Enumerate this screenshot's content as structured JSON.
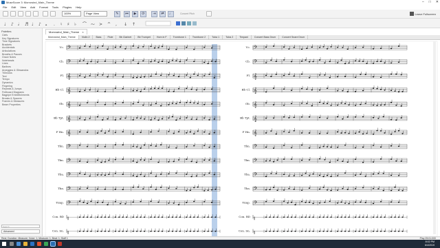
{
  "window": {
    "title": "MuseScore 3: Morrowind_Main_Theme",
    "controls": [
      "–",
      "□",
      "✕"
    ]
  },
  "menus": [
    "File",
    "Edit",
    "View",
    "Add",
    "Format",
    "Tools",
    "Plugins",
    "Help"
  ],
  "toolbar": {
    "zoom": "100%",
    "view_mode": "Page View",
    "concert_pitch": "Concert Pitch",
    "leave_fullscreen": "Leave Fullscreen"
  },
  "palette": {
    "title": "Palettes",
    "items": [
      "Clefs",
      "Key Signatures",
      "Time Signatures",
      "Brackets",
      "Accidentals",
      "Articulations",
      "Breaths & Pauses",
      "Grace Notes",
      "Noteheads",
      "Lines",
      "Barlines",
      "Arpeggios & Glissandos",
      "Tremolos",
      "Text",
      "Tempo",
      "Dynamics",
      "Fingering",
      "Repeats & Jumps",
      "Fretboard Diagrams",
      "Bagpipe Embellishments",
      "Breaks & Spacers",
      "Frames & Measures",
      "Beam Properties"
    ],
    "search_placeholder": "Search",
    "mode": "Advanced"
  },
  "score_tab": {
    "label": "Morrowind_Main_Theme",
    "close": "×"
  },
  "parts": [
    "Morrowind_Main_Theme",
    "Violin 2",
    "Bass",
    "Flute",
    "Bb Clarinet",
    "Bb Trumpet",
    "Horn in F",
    "Trombone 1",
    "Trombone 2",
    "Tuba 1",
    "Tuba 2",
    "Timpani",
    "Concert Bass Drum",
    "Concert Snare Drum"
  ],
  "staves": [
    "Vc.",
    "Cb.",
    "Fl.",
    "Bb Cl.",
    "Ob.",
    "Bb Tpt.",
    "F Hn.",
    "Tbn.",
    "Tbn.",
    "Tba.",
    "Tba.",
    "Timp.",
    "Con. BD",
    "Con. Sn."
  ],
  "status": {
    "left": "Rest; Duration: Measure; Voice: 1; Measure: 1; Beat: 1; Staff 1",
    "right": "Play   25:01:000"
  },
  "taskbar": {
    "time": "8:02 PM",
    "date": "6/4/2019"
  },
  "colors": {
    "accent": "#2a6fb0",
    "selection": "#a9c4e6",
    "taskbar": "#1f2a38"
  }
}
